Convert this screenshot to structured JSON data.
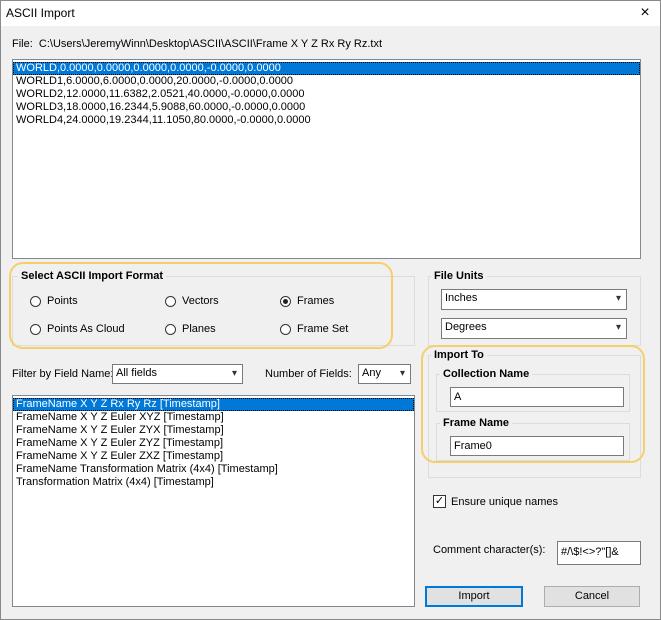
{
  "window": {
    "title": "ASCII Import",
    "close_icon": "×"
  },
  "file": {
    "label": "File:",
    "path": "C:\\Users\\JeremyWinn\\Desktop\\ASCII\\ASCII\\Frame X Y Z Rx Ry Rz.txt"
  },
  "preview_lines": [
    "WORLD,0.0000,0.0000,0.0000,0.0000,-0.0000,0.0000",
    "WORLD1,6.0000,6.0000,0.0000,20.0000,-0.0000,0.0000",
    "WORLD2,12.0000,11.6382,2.0521,40.0000,-0.0000,0.0000",
    "WORLD3,18.0000,16.2344,5.9088,60.0000,-0.0000,0.0000",
    "WORLD4,24.0000,19.2344,11.1050,80.0000,-0.0000,0.0000"
  ],
  "format": {
    "title": "Select ASCII Import Format",
    "options": [
      "Points",
      "Vectors",
      "Frames",
      "Points As Cloud",
      "Planes",
      "Frame Set"
    ],
    "selected": "Frames"
  },
  "units": {
    "title": "File Units",
    "length": "Inches",
    "angle": "Degrees"
  },
  "filter": {
    "label": "Filter by Field Name:",
    "value": "All fields",
    "num_label": "Number of Fields:",
    "num_value": "Any"
  },
  "fields": [
    "FrameName X Y Z  Rx Ry Rz [Timestamp]",
    "FrameName X Y Z  Euler XYZ [Timestamp]",
    "FrameName X Y Z  Euler ZYX [Timestamp]",
    "FrameName X Y Z  Euler ZYZ [Timestamp]",
    "FrameName X Y Z  Euler ZXZ [Timestamp]",
    "FrameName Transformation Matrix (4x4) [Timestamp]",
    "Transformation Matrix (4x4) [Timestamp]"
  ],
  "import_to": {
    "title": "Import To",
    "collection_label": "Collection Name",
    "collection_value": "A",
    "frame_label": "Frame Name",
    "frame_value": "Frame0"
  },
  "ensure_unique": {
    "label": "Ensure unique names",
    "checked": "✓"
  },
  "comment": {
    "label": "Comment character(s):",
    "value": "#/\\$!<>?\"[]&"
  },
  "buttons": {
    "import": "Import",
    "cancel": "Cancel"
  },
  "icons": {
    "dropdown": "▾"
  },
  "colors": {
    "selection": "#0078d7",
    "highlight": "#f6cf6b"
  }
}
